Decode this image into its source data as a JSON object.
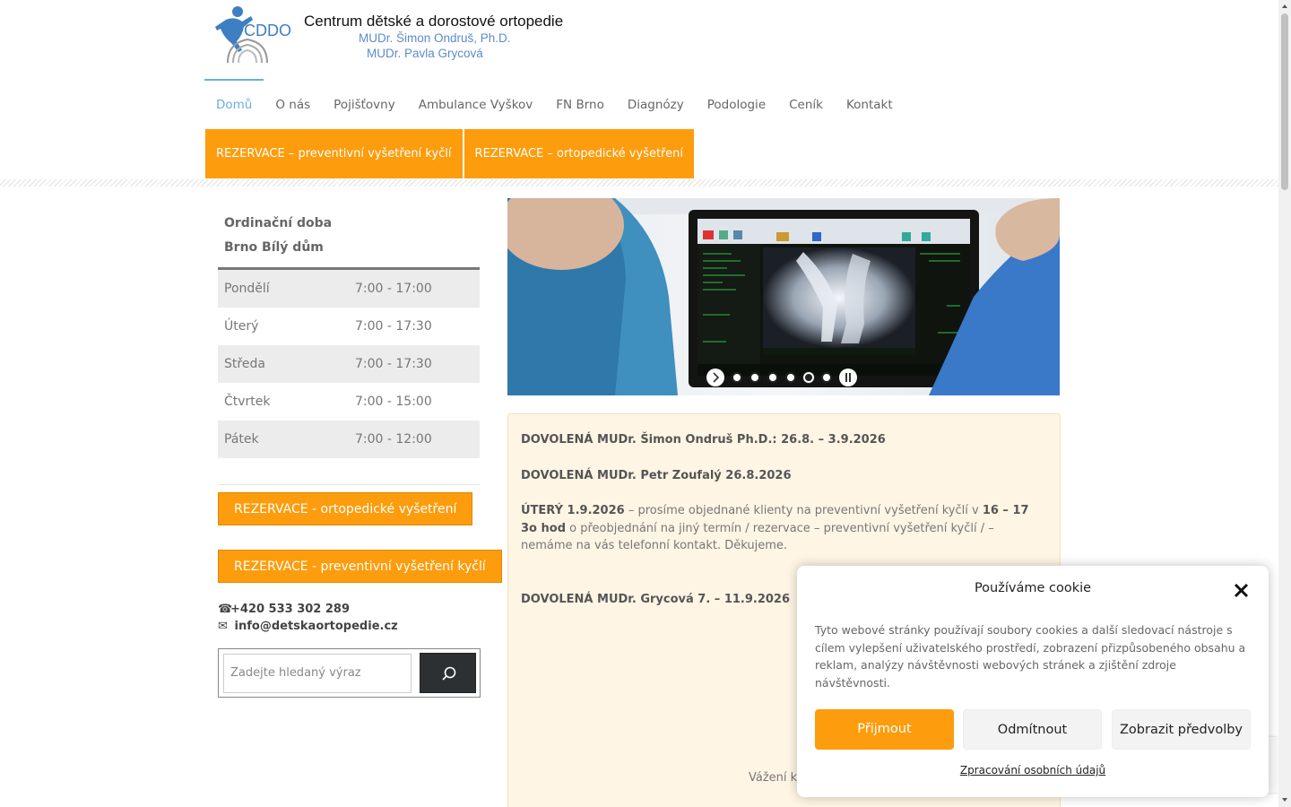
{
  "header": {
    "logo_text": "CDDO",
    "title": "Centrum dětské a dorostové ortopedie",
    "doctor1": "MUDr. Šimon Ondruš, Ph.D.",
    "doctor2": "MUDr. Pavla Grycová"
  },
  "nav": {
    "items": [
      "Domů",
      "O nás",
      "Pojišťovny",
      "Ambulance Vyškov",
      "FN Brno",
      "Diagnózy",
      "Podologie",
      "Ceník",
      "Kontakt"
    ],
    "active": "Domů"
  },
  "reservation_bar": {
    "btn1": "REZERVACE – preventivní vyšetření kyčlí",
    "btn2": "REZERVACE – ortopedické vyšetření"
  },
  "sidebar": {
    "hours_title1": "Ordinační doba",
    "hours_title2": "Brno Bílý dům",
    "hours": [
      {
        "day": "Pondělí",
        "time": "7:00 - 17:00"
      },
      {
        "day": "Úterý",
        "time": "7:00 - 17:30"
      },
      {
        "day": "Středa",
        "time": "7:00 - 17:30"
      },
      {
        "day": "Čtvrtek",
        "time": "7:00 - 15:00"
      },
      {
        "day": "Pátek",
        "time": "7:00 - 12:00"
      }
    ],
    "btn_ortho": "REZERVACE - ortopedické vyšetření",
    "btn_prevent": "REZERVACE - preventivní vyšetření kyčlí",
    "phone": "+420 533 302 289",
    "email": "info@detskaortopedie.cz",
    "search_placeholder": "Zadejte hledaný výraz"
  },
  "slider": {
    "dot_count": 6,
    "current_dot": 5
  },
  "notice": {
    "line1": "DOVOLENÁ MUDr. Šimon Ondruš Ph.D.: 26.8. – 3.9.2026",
    "line2": "DOVOLENÁ MUDr. Petr Zoufalý 26.8.2026",
    "line3_bold": "ÚTERÝ 1.9.2026",
    "line3_a": " – prosíme objednané klienty na preventivní vyšetření kyčlí v ",
    "line3_bold2": "16 – 17 3o hod",
    "line3_b": " o přeobjednání na jiný termín / rezervace – preventivní vyšetření kyčlí / – nemáme na vás telefonní kontakt. Děkujeme.",
    "line4": "DOVOLENÁ MUDr. Grycová 7. – 11.9.2026",
    "tail": "Vážení kli"
  },
  "cookie": {
    "title": "Používáme cookie",
    "text": "Tyto webové stránky používají soubory cookies a další sledovací nástroje s cílem vylepšení uživatelského prostředí, zobrazení přizpůsobeného obsahu a reklam, analýzy návštěvnosti webových stránek a zjištění zdroje návštěvnosti.",
    "accept": "Přijmout",
    "deny": "Odmítnout",
    "prefs": "Zobrazit předvolby",
    "link": "Zpracování osobních údajů"
  },
  "colors": {
    "accent": "#fd9c0c",
    "nav_active": "#69aede",
    "notice_bg": "#fef5e4"
  }
}
